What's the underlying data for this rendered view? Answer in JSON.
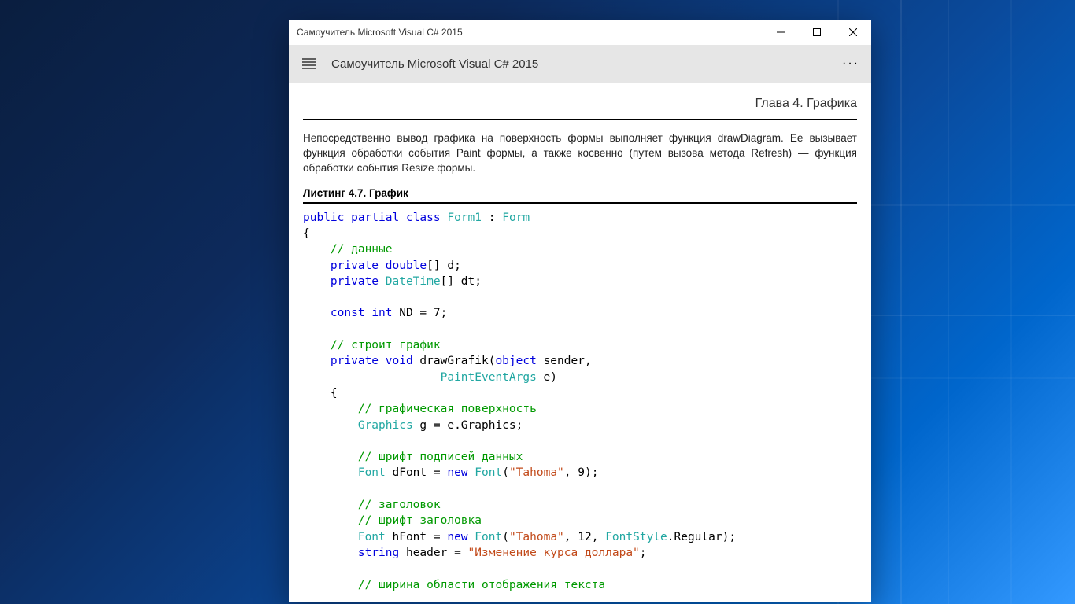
{
  "window": {
    "title": "Самоучитель Microsoft Visual C# 2015"
  },
  "toolbar": {
    "title": "Самоучитель Microsoft Visual C# 2015"
  },
  "chapter": "Глава 4. Графика",
  "paragraph": "Непосредственно вывод графика на поверхность формы выполняет функция drawDiagram. Ее вызывает функция обработки события Paint формы, а также косвенно (путем вызова метода Refresh) — функция обработки события Resize формы.",
  "listing": "Листинг 4.7. График",
  "code": {
    "c1": "// данные",
    "c2": "// строит график",
    "c3": "// графическая поверхность",
    "c4": "// шрифт подписей данных",
    "c5": "// заголовок",
    "c6": "// шрифт заголовка",
    "c7": "// ширина области отображения текста",
    "s1": "\"Tahoma\"",
    "s2": "\"Tahoma\"",
    "s3": "\"Изменение курса доллара\"",
    "kw_public": "public",
    "kw_partial": "partial",
    "kw_class": "class",
    "kw_private": "private",
    "kw_double": "double",
    "kw_const": "const",
    "kw_int": "int",
    "kw_void": "void",
    "kw_object": "object",
    "kw_new": "new",
    "kw_string": "string",
    "cls_Form1": "Form1",
    "cls_Form": "Form",
    "cls_DateTime": "DateTime",
    "cls_PaintEventArgs": "PaintEventArgs",
    "cls_Graphics": "Graphics",
    "cls_Font": "Font",
    "cls_FontStyle": "FontStyle",
    "n7": "7",
    "n9": "9",
    "n12": "12",
    "txt_d": "[] d;",
    "txt_dt": "[] dt;",
    "txt_nd": " ND = ",
    "txt_semicolon": ";",
    "txt_drawGrafik": " drawGrafik(",
    "txt_sender": " sender,",
    "txt_e": " e)",
    "txt_g": " g = e.Graphics;",
    "txt_dFont": " dFont = ",
    "txt_hFont": " hFont = ",
    "txt_fontOpen": "(",
    "txt_comma9": ", ",
    "txt_comma12": ", ",
    "txt_close": ");",
    "txt_regular": ".Regular);",
    "txt_header": " header = ",
    "txt_colon": " : ",
    "txt_brace_open": "{",
    "txt_brace_open2": "{",
    "txt_space4": "    ",
    "txt_space8": "        "
  }
}
